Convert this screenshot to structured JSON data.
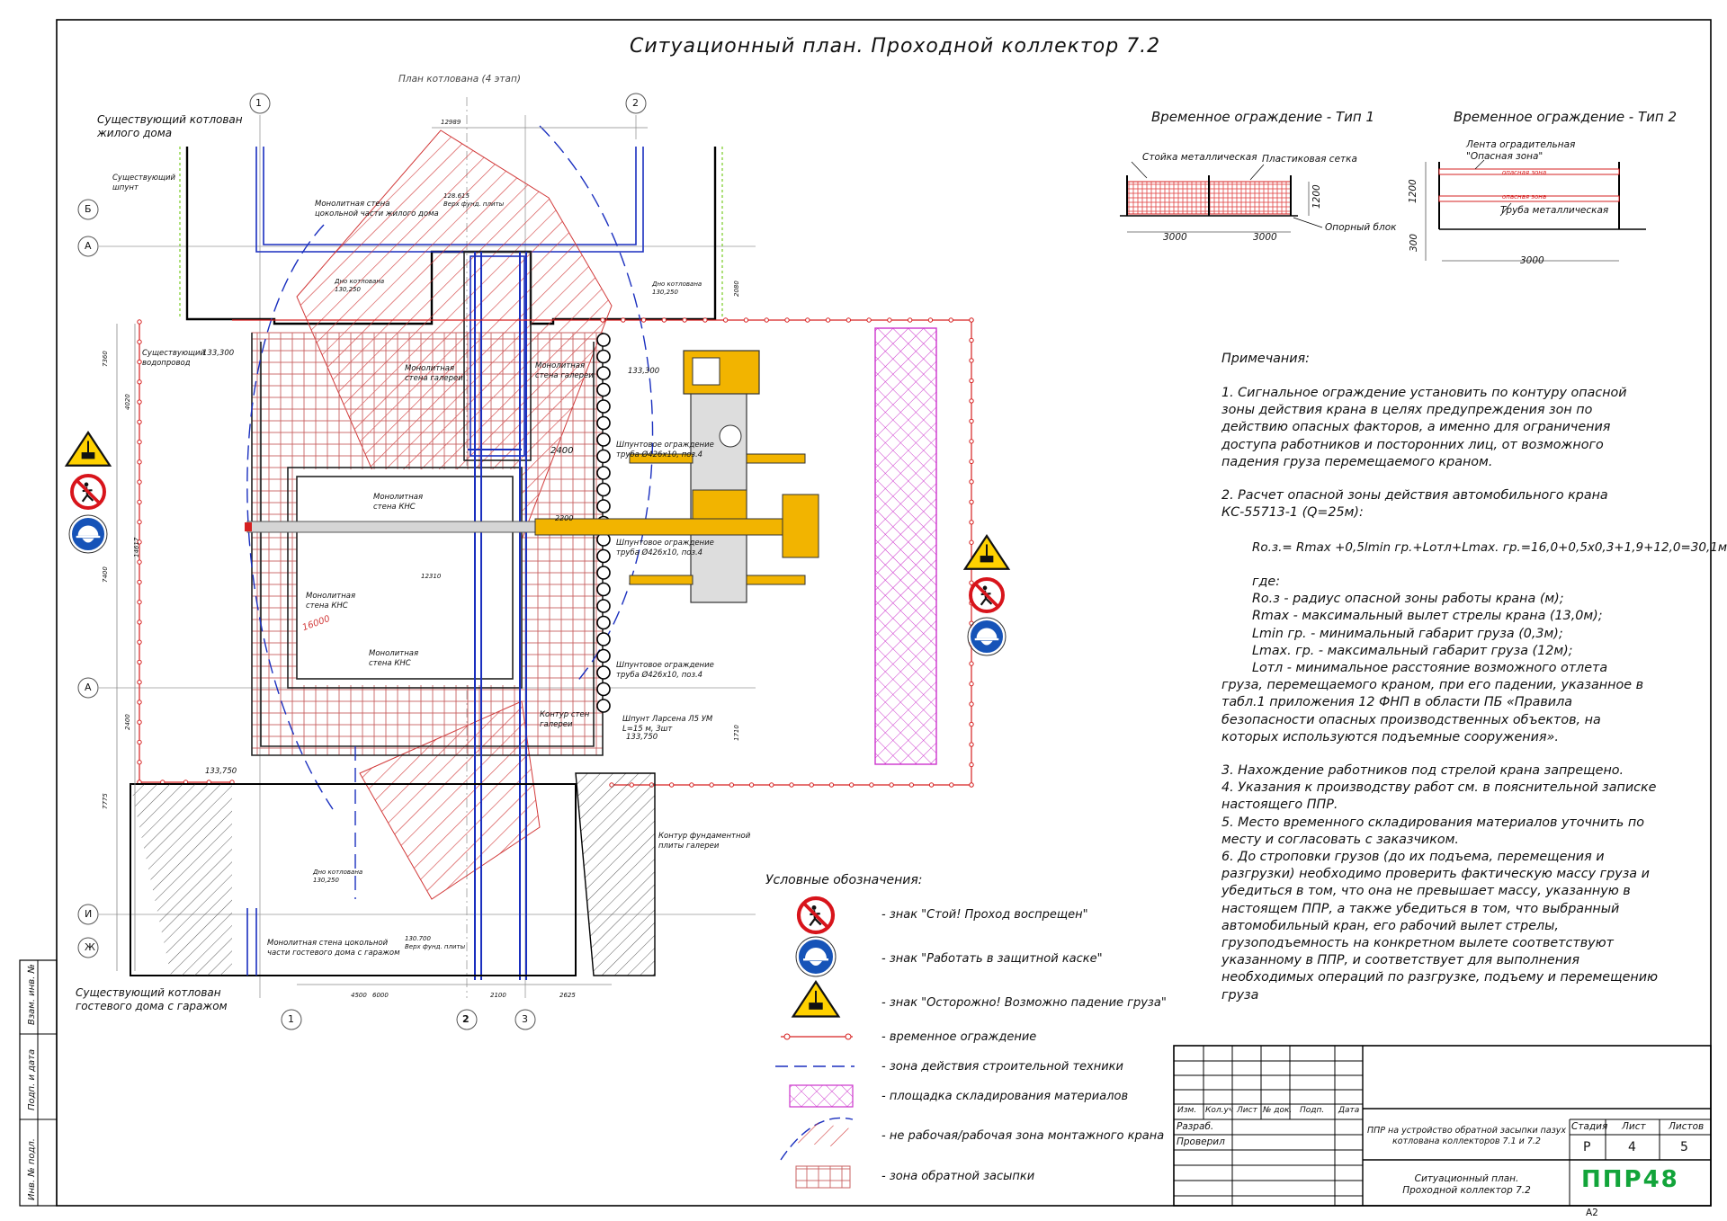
{
  "title": "Ситуационный план. Проходной коллектор 7.2",
  "plan_subtitle": "План котлована (4 этап)",
  "axes": {
    "a1": "1",
    "a2": "2",
    "a3": "3",
    "b": "Б",
    "a": "А",
    "a_lower": "А",
    "i": "И",
    "zh": "Ж"
  },
  "plan_labels": {
    "existing_pit_residential": "Существующий котлован\nжилого дома",
    "existing_sheet_pile": "Существующий\nшпунт",
    "monolith_wall_basement_res": "Монолитная стена\nцокольной части жилого дома",
    "existing_water": "Существующий\nводопровод",
    "monolith_gallery_wall_1": "Монолитная\nстена галереи",
    "monolith_gallery_wall_2": "Монолитная\nстена галереи",
    "monolith_kns_1": "Монолитная\nстена КНС",
    "monolith_kns_2": "Монолитная\nстена КНС",
    "monolith_kns_3": "Монолитная\nстена КНС",
    "pile_fence_1": "Шпунтовое ограждение\nтруба Ø426х10, поз.4",
    "pile_fence_2": "Шпунтовое ограждение\nтруба Ø426х10, поз.4",
    "pile_fence_3": "Шпунтовое ограждение\nтруба Ø426х10, поз.4",
    "larssen": "Шпунт Ларсена Л5 УМ\nL=15 м, 3шт",
    "gallery_contour": "Контур стен\nгалереи",
    "foundation_contour": "Контур фундаментной\nплиты галереи",
    "monolith_wall_guest": "Монолитная стена цокольной\nчасти гостевого дома с гаражом",
    "existing_pit_guest": "Существующий котлован\nгостевого дома с гаражом",
    "bottom_pit_1": "Дно котлована\n130,250",
    "bottom_pit_2": "Дно котлована\n130,250",
    "bottom_pit_3": "Дно котлована\n130,250",
    "top_slab_1": "128.615\nВерх фунд. плиты",
    "top_slab_2": "130.700\nВерх фунд. плиты",
    "elev_1": "133,300",
    "elev_2": "133,300",
    "elev_3": "133,750",
    "elev_4": "133,750",
    "dim_2400": "2400",
    "dim_2200": "2200",
    "radius_16000": "16000",
    "dim_12310": "12310",
    "dim_12989": "12989",
    "dim_4500": "4500",
    "dim_6000": "6000",
    "dim_2100": "2100",
    "dim_2625": "2625",
    "dim_14617": "14617",
    "dim_4020": "4020",
    "dim_7400": "7400",
    "dim_2400v": "2400",
    "dim_7775": "7775",
    "dim_2080": "2080",
    "dim_7360": "7360",
    "dim_1710": "1710"
  },
  "fence": {
    "type1_title": "Временное ограждение - Тип 1",
    "type2_title": "Временное ограждение - Тип 2",
    "post_label": "Стойка металлическая",
    "mesh_label": "Пластиковая сетка",
    "base_label": "Опорный блок",
    "tape_label": "Лента оградительная\n\"Опасная зона\"",
    "pipe_label": "Труба металлическая",
    "zone_text": "опасная зона",
    "dim_3000a": "3000",
    "dim_3000b": "3000",
    "dim_1200": "1200",
    "dim_1200b": "1200",
    "dim_300": "300",
    "dim_3000c": "3000"
  },
  "notes": {
    "heading": "Примечания:",
    "p1": "1.  Сигнальное ограждение установить по контуру опасной зоны действия крана в целях предупреждения зон по действию опасных факторов, а именно для ограничения доступа работников и посторонних лиц, от возможного падения груза перемещаемого краном.",
    "p2": "2. Расчет опасной зоны действия автомобильного крана КС-55713-1 (Q=25м):",
    "formula": "Rо.з.= Rmax +0,5lmin гр.+Lотл+Lmax. гр.=16,0+0,5х0,3+1,9+12,0=30,1м",
    "where": "где:",
    "w1": "Rо.з - радиус опасной зоны работы крана (м);",
    "w2": "Rmax - максимальный вылет стрелы крана (13,0м);",
    "w3": "Lmin гр. - минимальный габарит груза (0,3м);",
    "w4": "Lmax. гр. - максимальный габарит груза (12м);",
    "w5": "Lотл - минимальное расстояние возможного отлета груза, перемещаемого краном, при его падении, указанное в табл.1 приложения 12 ФНП в области ПБ «Правила безопасности опасных производственных объектов, на которых используются подъемные сооружения».",
    "p3": "3. Нахождение работников под стрелой крана запрещено.",
    "p4": "4.       Указания к производству работ см. в пояснительной записке настоящего ППР.",
    "p5": "5. Место временного складирования материалов уточнить по месту и согласовать с заказчиком.",
    "p6": "6. До строповки грузов (до их подъема, перемещения и разгрузки) необходимо проверить фактическую массу груза и убедиться в том, что она не превышает массу, указанную в настоящем ППР, а также убедиться в том, что выбранный автомобильный кран, его рабочий вылет стрелы, грузоподъемность на конкретном вылете соответствуют указанному в ППР, и соответствует для выполнения необходимых операций по разгрузке, подъему и перемещению груза"
  },
  "legend": {
    "heading": "Условные обозначения:",
    "items": [
      "- знак \"Стой! Проход воспрещен\"",
      "- знак \"Работать в защитной каске\"",
      "- знак \"Осторожно! Возможно падение груза\"",
      "- временное ограждение",
      "- зона действия строительной техники",
      "- площадка складирования материалов",
      "- не рабочая/рабочая зона монтажного крана",
      "- зона обратной засыпки"
    ]
  },
  "stamp": {
    "cols": [
      "Изм.",
      "Кол.уч",
      "Лист",
      "№ док.",
      "Подп.",
      "Дата"
    ],
    "role1": "Разраб.",
    "role2": "Проверил",
    "project": "ППР на устройство обратной засыпки пазух\nкотлована коллекторов 7.1 и 7.2",
    "drawing": "Ситуационный план.\nПроходной коллектор 7.2",
    "stage_h": "Стадия",
    "sheet_h": "Лист",
    "sheets_h": "Листов",
    "stage": "Р",
    "sheet": "4",
    "sheets": "5",
    "logo": "ППР48",
    "format": "A2"
  },
  "side_stamp": [
    "Взам. инв. №",
    "Подп. и дата",
    "Инв. № подл."
  ],
  "colors": {
    "hatch": "#d23a3a",
    "fence": "#d62020",
    "zone": "#1a2fbf",
    "storage": "#cc33cc",
    "crane": "#f2b400",
    "sign_red": "#d8141b",
    "sign_blue": "#1653b8",
    "sign_yellow": "#ffd100",
    "logo": "#12a43a"
  }
}
